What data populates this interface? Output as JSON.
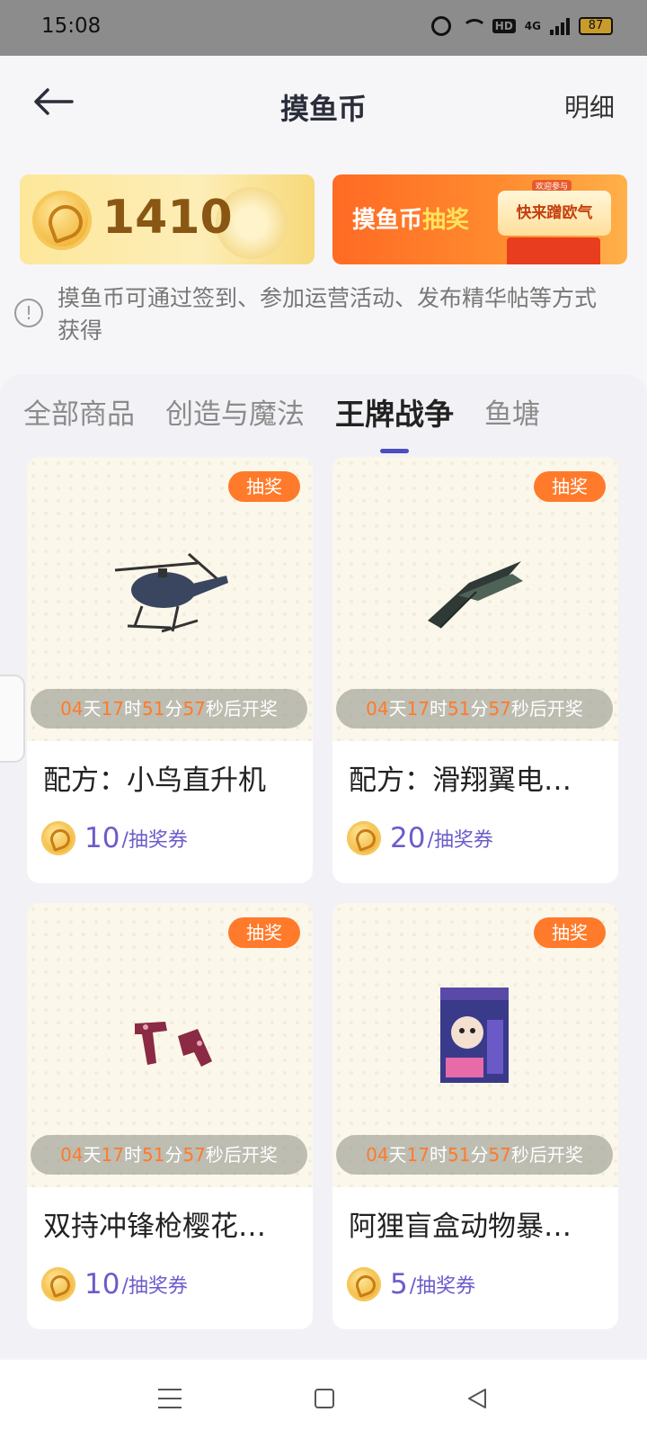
{
  "status": {
    "time": "15:08",
    "hd": "HD",
    "network": "4G",
    "battery": "87"
  },
  "header": {
    "title": "摸鱼币",
    "detail_label": "明细"
  },
  "balance": {
    "amount": "1410"
  },
  "lottery_banner": {
    "text_a": "摸鱼币",
    "text_b": "抽奖",
    "pill": "快来蹭欧气",
    "tag": "欢迎参与"
  },
  "info": {
    "line1": "摸鱼币可通过签到、参加运营活动、发布精华帖等方式",
    "line2": "获得"
  },
  "tabs": [
    {
      "label": "全部商品"
    },
    {
      "label": "创造与魔法"
    },
    {
      "label": "王牌战争",
      "active": true
    },
    {
      "label": "鱼塘"
    }
  ],
  "countdown": {
    "d": "04",
    "d_unit": "天",
    "h": "17",
    "h_unit": "时",
    "m": "51",
    "m_unit": "分",
    "s": "57",
    "s_unit": "秒后开奖"
  },
  "products": [
    {
      "badge": "抽奖",
      "title": "配方：小鸟直升机",
      "price": "10",
      "unit": "/抽奖券",
      "icon": "helicopter-image"
    },
    {
      "badge": "抽奖",
      "title": "配方：滑翔翼电…",
      "price": "20",
      "unit": "/抽奖券",
      "icon": "glider-image"
    },
    {
      "badge": "抽奖",
      "title": "双持冲锋枪樱花…",
      "price": "10",
      "unit": "/抽奖券",
      "icon": "dual-smg-image"
    },
    {
      "badge": "抽奖",
      "title": "阿狸盲盒动物暴…",
      "price": "5",
      "unit": "/抽奖券",
      "icon": "blind-box-image"
    }
  ],
  "colors": {
    "accent": "#4b4fbf",
    "badge": "#ff7a2a",
    "price": "#6b5ccb"
  }
}
